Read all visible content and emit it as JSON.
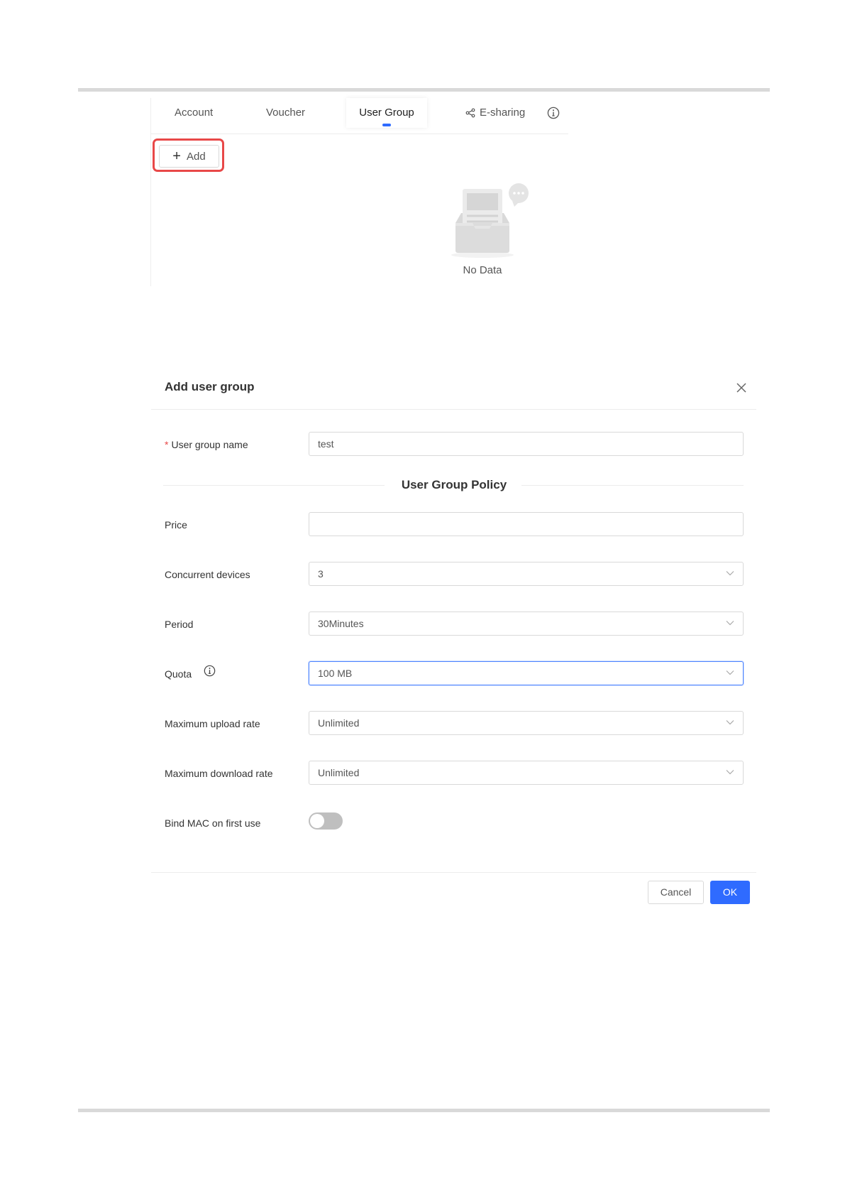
{
  "tabs": {
    "account": "Account",
    "voucher": "Voucher",
    "user_group": "User Group",
    "esharing": "E-sharing"
  },
  "toolbar": {
    "add_label": "Add"
  },
  "empty_state": {
    "text": "No Data"
  },
  "dialog": {
    "title": "Add user group",
    "section_title": "User Group Policy",
    "fields": {
      "user_group_name": {
        "label": "User group name",
        "value": "test",
        "required_mark": "*"
      },
      "price": {
        "label": "Price",
        "value": ""
      },
      "concurrent_devices": {
        "label": "Concurrent devices",
        "value": "3"
      },
      "period": {
        "label": "Period",
        "value": "30Minutes"
      },
      "quota": {
        "label": "Quota",
        "value": "100 MB"
      },
      "max_upload_rate": {
        "label": "Maximum upload rate",
        "value": "Unlimited"
      },
      "max_download_rate": {
        "label": "Maximum download rate",
        "value": "Unlimited"
      },
      "bind_mac": {
        "label": "Bind MAC on first use",
        "enabled": false
      }
    },
    "buttons": {
      "cancel": "Cancel",
      "ok": "OK"
    }
  },
  "colors": {
    "accent": "#2f6bff",
    "highlight_border": "#e84848",
    "toggle_off": "#bfbfbf"
  },
  "icons": [
    "plus-icon",
    "share-icon",
    "info-icon",
    "close-icon",
    "chevron-down-icon",
    "empty-inbox-icon"
  ]
}
